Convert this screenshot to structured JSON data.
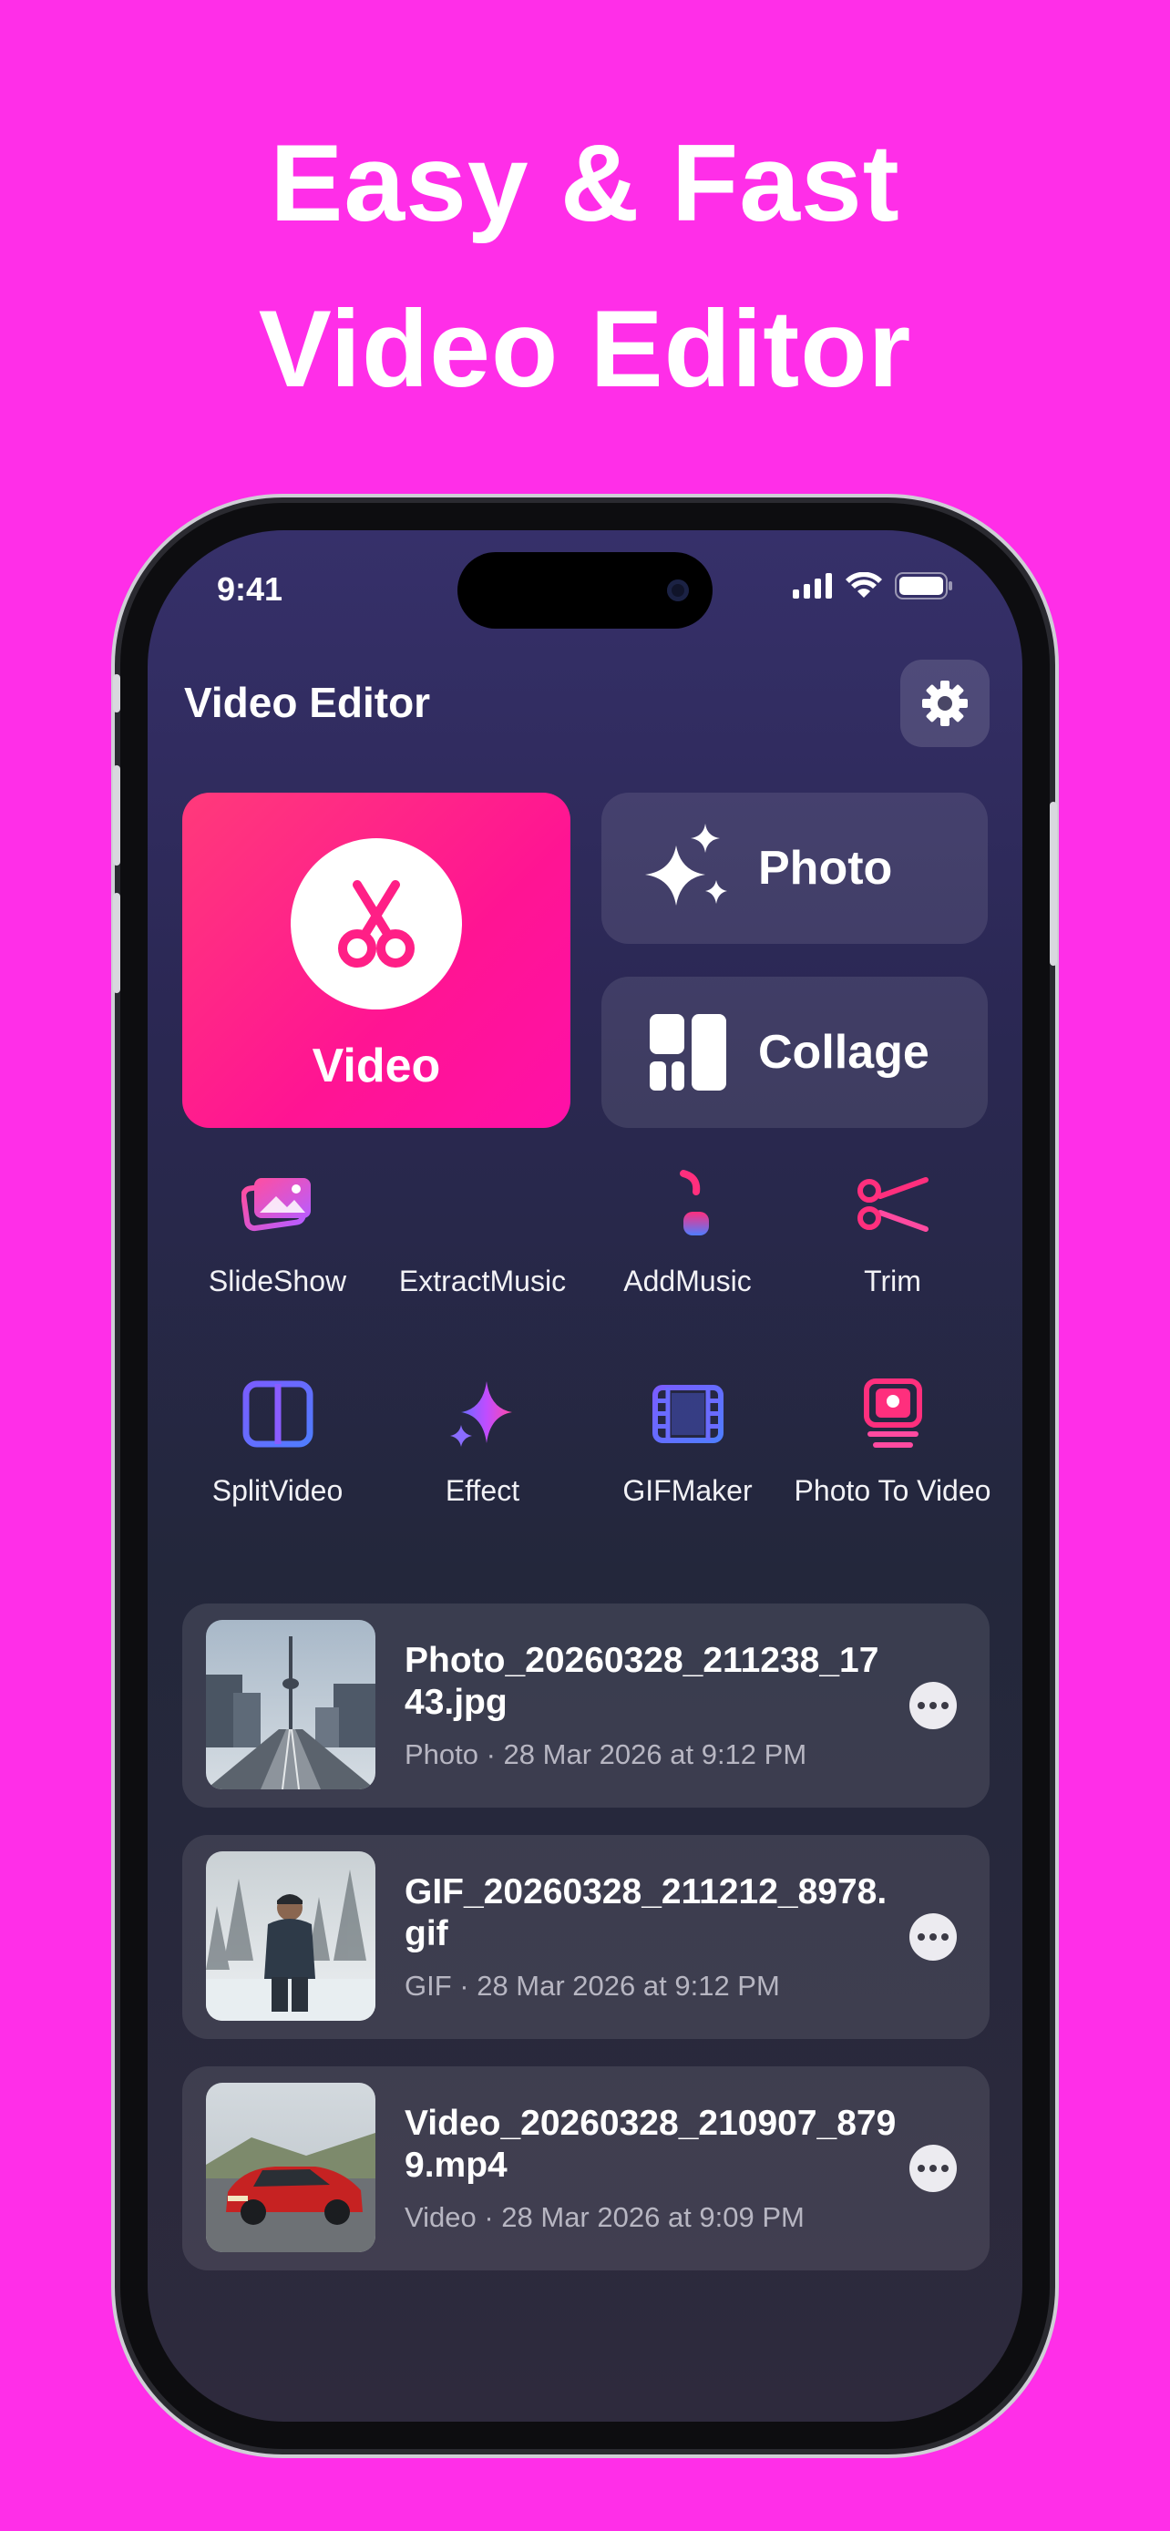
{
  "promo": {
    "line1": "Easy & Fast",
    "line2": "Video Editor"
  },
  "status_bar": {
    "time": "9:41"
  },
  "header": {
    "title": "Video Editor"
  },
  "main_actions": {
    "video_label": "Video",
    "photo_label": "Photo",
    "collage_label": "Collage"
  },
  "tools": [
    {
      "label": "SlideShow",
      "icon": "slideshow-icon"
    },
    {
      "label": "Extract\nMusic",
      "icon": "waveform-icon"
    },
    {
      "label": "Add\nMusic",
      "icon": "music-note-icon"
    },
    {
      "label": "Trim",
      "icon": "scissors-icon"
    },
    {
      "label": "Split\nVideo",
      "icon": "split-icon"
    },
    {
      "label": "Effect",
      "icon": "sparkle-icon"
    },
    {
      "label": "GIF\nMaker",
      "icon": "film-icon"
    },
    {
      "label": "Photo To Video",
      "icon": "photo-to-video-icon"
    }
  ],
  "tool_labels": {
    "slideshow": "SlideShow",
    "extract_1": "Extract",
    "extract_2": "Music",
    "add_1": "Add",
    "add_2": "Music",
    "trim": "Trim",
    "split_1": "Split",
    "split_2": "Video",
    "effect": "Effect",
    "gif_1": "GIF",
    "gif_2": "Maker",
    "photo_to_video": "Photo To Video"
  },
  "recent_files": [
    {
      "name": "Photo_20260328_211238_1743.jpg",
      "meta": "Photo · 28 Mar 2026 at 9:12 PM"
    },
    {
      "name": "GIF_20260328_211212_8978.gif",
      "meta": "GIF · 28 Mar 2026 at 9:12 PM"
    },
    {
      "name": "Video_20260328_210907_8799.mp4",
      "meta": "Video · 28 Mar 2026 at 9:09 PM"
    }
  ],
  "colors": {
    "background": "#ff2ee8",
    "video_tile": "#ff1493",
    "accent_pink": "#ff2f7d",
    "accent_purple": "#a45cff",
    "accent_blue": "#4f7dff"
  }
}
